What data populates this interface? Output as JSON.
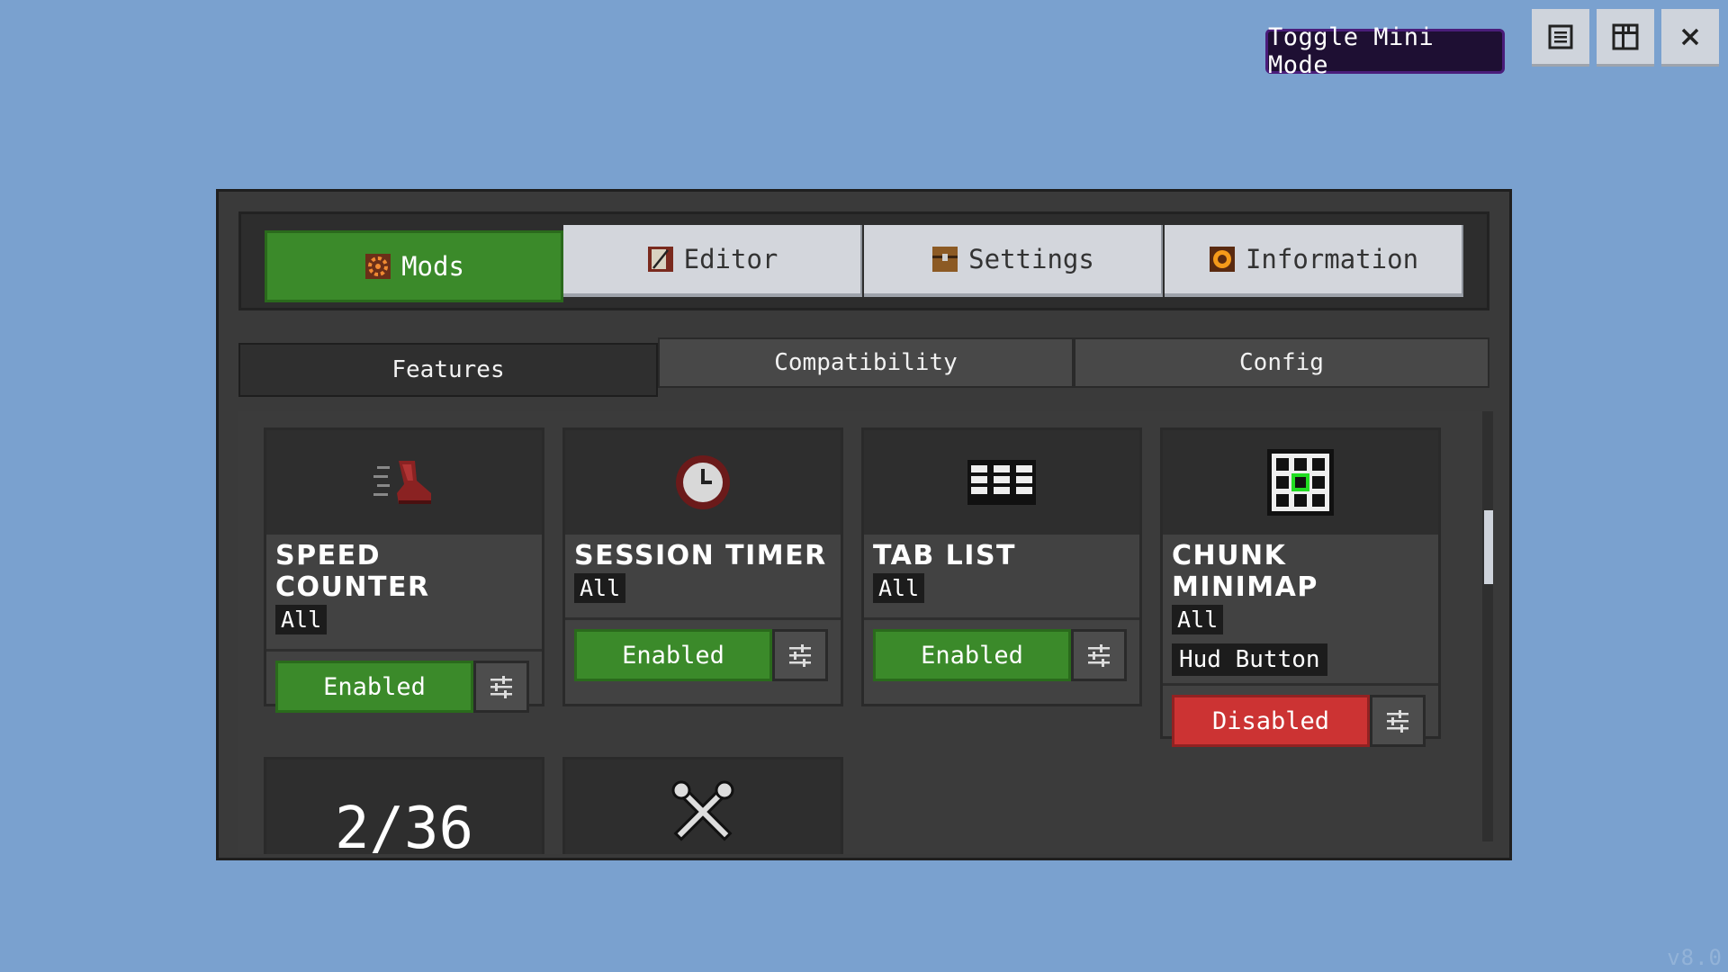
{
  "window": {
    "toggle_label": "Toggle Mini Mode",
    "version": "v8.0"
  },
  "tabs": [
    {
      "label": "Mods",
      "active": true
    },
    {
      "label": "Editor",
      "active": false
    },
    {
      "label": "Settings",
      "active": false
    },
    {
      "label": "Information",
      "active": false
    }
  ],
  "subtabs": [
    {
      "label": "Features",
      "active": true
    },
    {
      "label": "Compatibility",
      "active": false
    },
    {
      "label": "Config",
      "active": false
    }
  ],
  "cards": [
    {
      "title": "SPEED COUNTER",
      "badge": "All",
      "status": "Enabled",
      "icon": "boot-icon"
    },
    {
      "title": "SESSION TIMER",
      "badge": "All",
      "status": "Enabled",
      "icon": "clock-icon"
    },
    {
      "title": "TAB LIST",
      "badge": "All",
      "status": "Enabled",
      "icon": "list-icon"
    },
    {
      "title": "CHUNK MINIMAP",
      "badge": "All",
      "extra_badge": "Hud Button",
      "status": "Disabled",
      "icon": "grid-map-icon"
    }
  ],
  "counter": {
    "value": "2/36"
  },
  "colors": {
    "background": "#7aa1cf",
    "enabled": "#3b8a2a",
    "disabled": "#cc3333",
    "panel": "#3a3a3a"
  }
}
